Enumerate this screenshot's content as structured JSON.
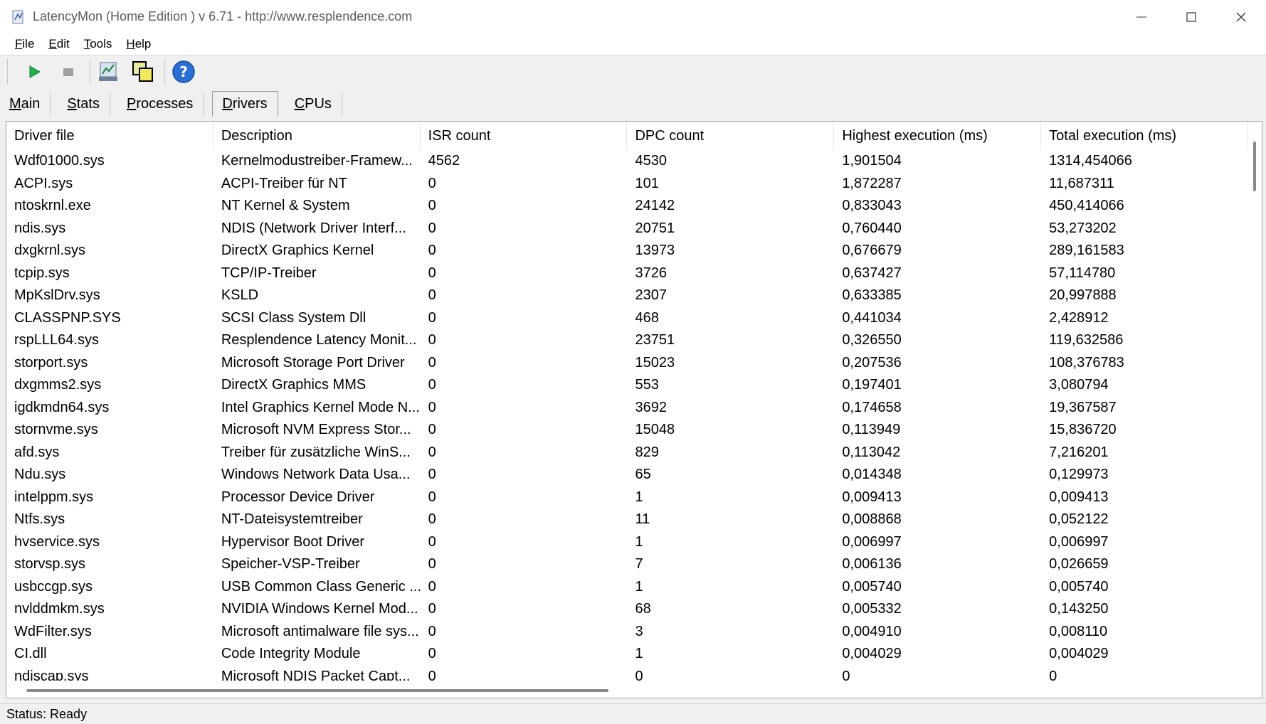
{
  "window": {
    "title": "LatencyMon  (Home Edition )  v 6.71 - http://www.resplendence.com"
  },
  "menu": [
    {
      "label": "File",
      "underline": "F",
      "rest": "ile"
    },
    {
      "label": "Edit",
      "underline": "E",
      "rest": "dit"
    },
    {
      "label": "Tools",
      "underline": "T",
      "rest": "ools"
    },
    {
      "label": "Help",
      "underline": "H",
      "rest": "elp"
    }
  ],
  "toolbar": {
    "icons": [
      "play-icon",
      "stop-icon",
      "analyze-icon",
      "windows-icon",
      "help-icon"
    ],
    "colors": {
      "play": "#22b14c",
      "stop": "#a0a0a0",
      "help": "#2a6fd6"
    }
  },
  "tabs": [
    {
      "label": "Main",
      "underline": "M",
      "rest": "ain",
      "active": false
    },
    {
      "label": "Stats",
      "underline": "S",
      "rest": "tats",
      "active": false
    },
    {
      "label": "Processes",
      "underline": "P",
      "rest": "rocesses",
      "active": false
    },
    {
      "label": "Drivers",
      "underline": "D",
      "rest": "rivers",
      "active": true
    },
    {
      "label": "CPUs",
      "underline": "C",
      "rest": "PUs",
      "active": false
    }
  ],
  "table": {
    "columns": [
      "Driver file",
      "Description",
      "ISR count",
      "DPC count",
      "Highest execution (ms)",
      "Total execution (ms)"
    ],
    "rows": [
      [
        "Wdf01000.sys",
        "Kernelmodustreiber-Framew...",
        "4562",
        "4530",
        "1,901504",
        "1314,454066"
      ],
      [
        "ACPI.sys",
        "ACPI-Treiber für NT",
        "0",
        "101",
        "1,872287",
        "11,687311"
      ],
      [
        "ntoskrnl.exe",
        "NT Kernel & System",
        "0",
        "24142",
        "0,833043",
        "450,414066"
      ],
      [
        "ndis.sys",
        "NDIS (Network Driver Interf...",
        "0",
        "20751",
        "0,760440",
        "53,273202"
      ],
      [
        "dxgkrnl.sys",
        "DirectX Graphics Kernel",
        "0",
        "13973",
        "0,676679",
        "289,161583"
      ],
      [
        "tcpip.sys",
        "TCP/IP-Treiber",
        "0",
        "3726",
        "0,637427",
        "57,114780"
      ],
      [
        "MpKslDrv.sys",
        "KSLD",
        "0",
        "2307",
        "0,633385",
        "20,997888"
      ],
      [
        "CLASSPNP.SYS",
        "SCSI Class System Dll",
        "0",
        "468",
        "0,441034",
        "2,428912"
      ],
      [
        "rspLLL64.sys",
        "Resplendence Latency Monit...",
        "0",
        "23751",
        "0,326550",
        "119,632586"
      ],
      [
        "storport.sys",
        "Microsoft Storage Port Driver",
        "0",
        "15023",
        "0,207536",
        "108,376783"
      ],
      [
        "dxgmms2.sys",
        "DirectX Graphics MMS",
        "0",
        "553",
        "0,197401",
        "3,080794"
      ],
      [
        "igdkmdn64.sys",
        "Intel Graphics Kernel Mode N...",
        "0",
        "3692",
        "0,174658",
        "19,367587"
      ],
      [
        "stornvme.sys",
        "Microsoft NVM Express Stor...",
        "0",
        "15048",
        "0,113949",
        "15,836720"
      ],
      [
        "afd.sys",
        "Treiber für zusätzliche WinS...",
        "0",
        "829",
        "0,113042",
        "7,216201"
      ],
      [
        "Ndu.sys",
        "Windows Network Data Usa...",
        "0",
        "65",
        "0,014348",
        "0,129973"
      ],
      [
        "intelppm.sys",
        "Processor Device Driver",
        "0",
        "1",
        "0,009413",
        "0,009413"
      ],
      [
        "Ntfs.sys",
        "NT-Dateisystemtreiber",
        "0",
        "11",
        "0,008868",
        "0,052122"
      ],
      [
        "hvservice.sys",
        "Hypervisor Boot Driver",
        "0",
        "1",
        "0,006997",
        "0,006997"
      ],
      [
        "storvsp.sys",
        "Speicher-VSP-Treiber",
        "0",
        "7",
        "0,006136",
        "0,026659"
      ],
      [
        "usbccgp.sys",
        "USB Common Class Generic ...",
        "0",
        "1",
        "0,005740",
        "0,005740"
      ],
      [
        "nvlddmkm.sys",
        "NVIDIA Windows Kernel Mod...",
        "0",
        "68",
        "0,005332",
        "0,143250"
      ],
      [
        "WdFilter.sys",
        "Microsoft antimalware file sys...",
        "0",
        "3",
        "0,004910",
        "0,008110"
      ],
      [
        "CI.dll",
        "Code Integrity Module",
        "0",
        "1",
        "0,004029",
        "0,004029"
      ],
      [
        "ndiscap.sys",
        "Microsoft NDIS Packet Capt...",
        "0",
        "0",
        "0",
        "0"
      ]
    ]
  },
  "status": {
    "text": "Status: Ready"
  }
}
